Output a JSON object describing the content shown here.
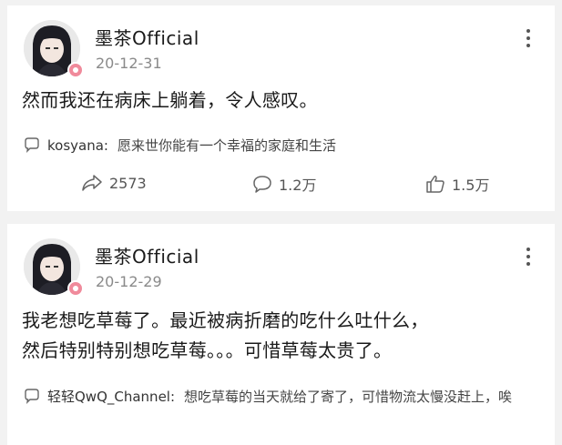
{
  "posts": [
    {
      "author": "墨茶Official",
      "date": "20-12-31",
      "content_lines": [
        "然而我还在病床上躺着，令人感叹。"
      ],
      "comment": {
        "user": "kosyana",
        "colon": ":",
        "text": "愿来世你能有一个幸福的家庭和生活"
      },
      "actions": {
        "share": "2573",
        "comments": "1.2万",
        "likes": "1.5万"
      }
    },
    {
      "author": "墨茶Official",
      "date": "20-12-29",
      "content_lines": [
        "我老想吃草莓了。最近被病折磨的吃什么吐什么，",
        "然后特别特别想吃草莓。。。可惜草莓太贵了。"
      ],
      "comment": {
        "user": "轻轻QwQ_Channel",
        "colon": ":",
        "text": "想吃草莓的当天就给了寄了，可惜物流太慢没赶上，唉"
      }
    }
  ],
  "icons": {
    "more": "more-vertical-icon",
    "comment": "speech-bubble-icon",
    "share": "share-arrow-icon",
    "like": "thumbs-up-icon"
  },
  "colors": {
    "text": "#1a1a1a",
    "muted": "#8a8a8a",
    "badge": "#f08a9b"
  }
}
